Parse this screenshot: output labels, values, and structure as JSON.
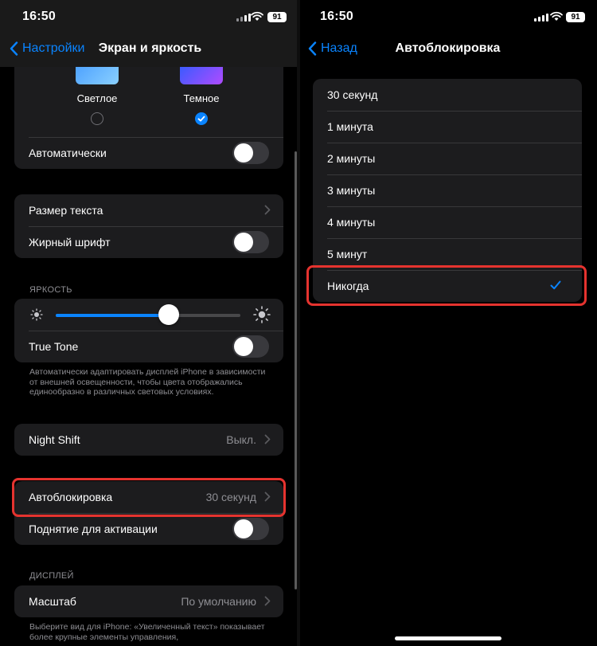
{
  "colors": {
    "accent": "#0a84ff",
    "highlight": "#e5332f",
    "cell": "#1c1c1e",
    "secondary_text": "#8e8e93"
  },
  "left": {
    "status": {
      "time": "16:50",
      "battery": "91"
    },
    "nav": {
      "back_label": "Настройки",
      "title": "Экран и яркость"
    },
    "appearance": {
      "light_label": "Светлое",
      "dark_label": "Темное",
      "auto_label": "Автоматически",
      "selected": "dark"
    },
    "text": {
      "size_label": "Размер текста",
      "bold_label": "Жирный шрифт"
    },
    "brightness": {
      "header": "ЯРКОСТЬ",
      "level": 0.61,
      "true_tone_label": "True Tone",
      "footnote": "Автоматически адаптировать дисплей iPhone в зависимости от внешней освещенности, чтобы цвета отображались единообразно в различных световых условиях."
    },
    "night_shift": {
      "label": "Night Shift",
      "value": "Выкл."
    },
    "lock": {
      "autolock_label": "Автоблокировка",
      "autolock_value": "30 секунд",
      "raise_label": "Поднятие для активации"
    },
    "display": {
      "header": "ДИСПЛЕЙ",
      "zoom_label": "Масштаб",
      "zoom_value": "По умолчанию",
      "footnote": "Выберите вид для iPhone: «Увеличенный текст» показывает более крупные элементы управления,"
    }
  },
  "right": {
    "status": {
      "time": "16:50",
      "battery": "91"
    },
    "nav": {
      "back_label": "Назад",
      "title": "Автоблокировка"
    },
    "options": [
      "30 секунд",
      "1 минута",
      "2 минуты",
      "3 минуты",
      "4 минуты",
      "5 минут",
      "Никогда"
    ],
    "selected_option": "Никогда"
  },
  "icons": [
    "chevron-left-icon",
    "chevron-right-icon",
    "checkmark-icon",
    "sun-icon",
    "signal-icon",
    "wifi-icon",
    "battery-icon"
  ]
}
